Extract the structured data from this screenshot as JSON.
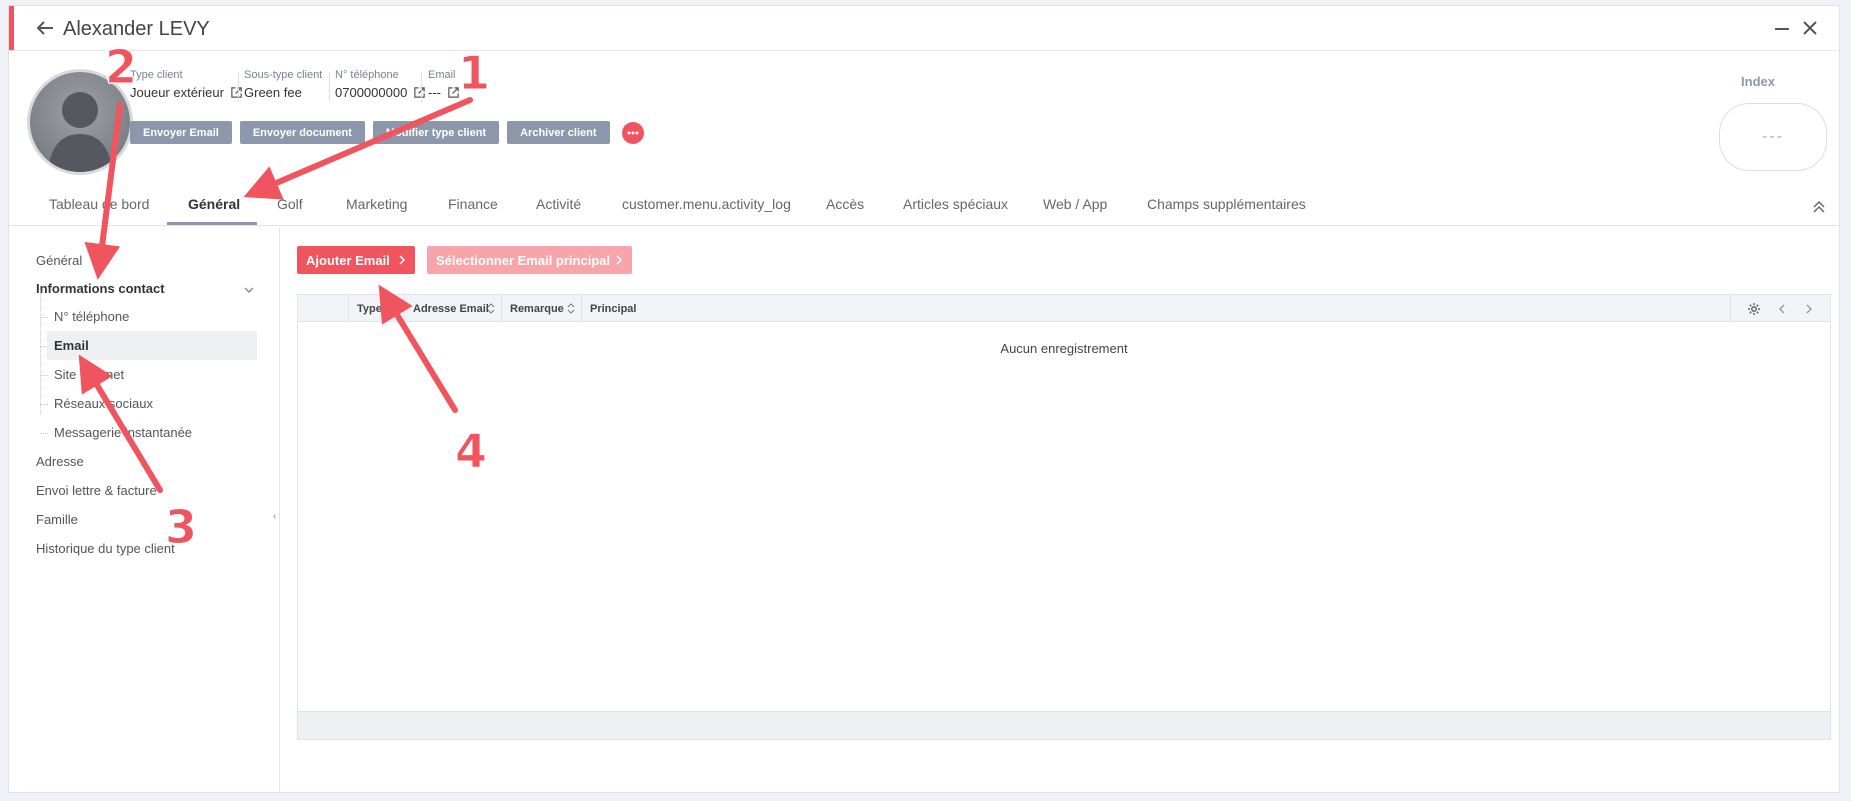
{
  "window": {
    "title": "Alexander LEVY"
  },
  "profile": {
    "fields": [
      {
        "label": "Type client",
        "value": "Joueur extérieur",
        "link": true
      },
      {
        "label": "Sous-type client",
        "value": "Green fee",
        "link": false
      },
      {
        "label": "N° téléphone",
        "value": "0700000000",
        "link": true
      },
      {
        "label": "Email",
        "value": "---",
        "link": true
      }
    ],
    "actions": [
      "Envoyer Email",
      "Envoyer document",
      "Modifier type client",
      "Archiver client"
    ],
    "index_label": "Index",
    "index_value": "---"
  },
  "tabs": [
    "Tableau de bord",
    "Général",
    "Golf",
    "Marketing",
    "Finance",
    "Activité",
    "customer.menu.activity_log",
    "Accès",
    "Articles spéciaux",
    "Web / App",
    "Champs supplémentaires"
  ],
  "active_tab": "Général",
  "sidebar": {
    "general": "Général",
    "contact": "Informations contact",
    "sub_items": [
      "N° téléphone",
      "Email",
      "Site Internet",
      "Réseaux sociaux",
      "Messagerie instantanée"
    ],
    "active_sub": "Email",
    "items_after": [
      "Adresse",
      "Envoi lettre & facture",
      "Famille",
      "Historique du type client"
    ]
  },
  "main": {
    "add_button": "Ajouter Email",
    "select_button": "Sélectionner Email principal",
    "columns": [
      "Type",
      "Adresse Email",
      "Remarque",
      "Principal"
    ],
    "empty_text": "Aucun enregistrement"
  },
  "annotations": [
    "1",
    "2",
    "3",
    "4"
  ],
  "colors": {
    "accent": "#f0545f",
    "action_button": "#8d97ab",
    "accent_light": "#f7a4aa"
  }
}
